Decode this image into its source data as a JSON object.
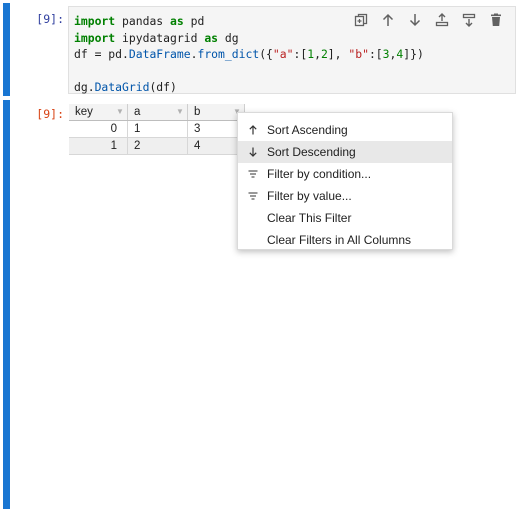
{
  "input_cell": {
    "prompt": "[9]:",
    "code_lines": [
      "import pandas as pd",
      "import ipydatagrid as dg",
      "df = pd.DataFrame.from_dict({\"a\":[1,2], \"b\":[3,4]})",
      "",
      "dg.DataGrid(df)"
    ],
    "toolbar": [
      "duplicate-icon",
      "move-up-icon",
      "move-down-icon",
      "insert-above-icon",
      "insert-below-icon",
      "delete-icon"
    ]
  },
  "output_cell": {
    "prompt": "[9]:",
    "grid": {
      "columns": [
        "key",
        "a",
        "b"
      ],
      "rows": [
        [
          "0",
          "1",
          "3"
        ],
        [
          "1",
          "2",
          "4"
        ]
      ]
    }
  },
  "context_menu": {
    "items": [
      {
        "label": "Sort Ascending",
        "icon": "arrow-up-icon"
      },
      {
        "label": "Sort Descending",
        "icon": "arrow-down-icon",
        "highlighted": true
      },
      {
        "label": "Filter by condition...",
        "icon": "filter-icon"
      },
      {
        "label": "Filter by value...",
        "icon": "filter-icon"
      },
      {
        "label": "Clear This Filter",
        "icon": ""
      },
      {
        "label": "Clear Filters in All Columns",
        "icon": ""
      }
    ]
  },
  "colors": {
    "cell_bar": "#1976d2",
    "input_prompt": "#303f9f",
    "output_prompt": "#d84315"
  }
}
